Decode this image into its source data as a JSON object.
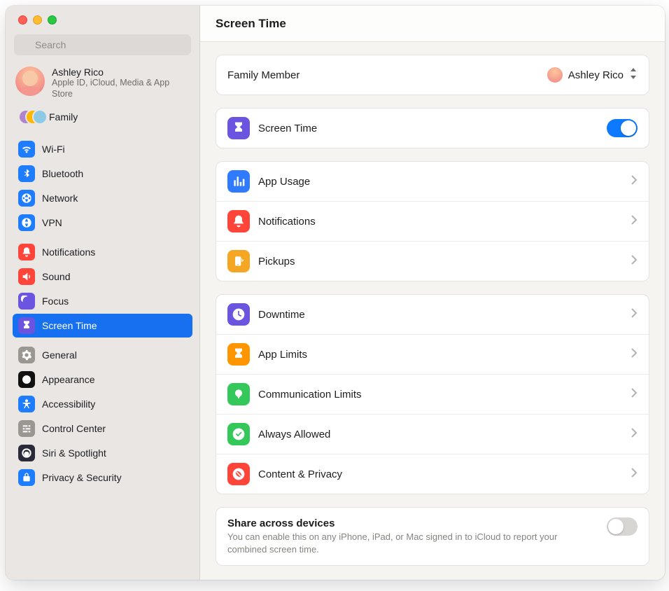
{
  "window": {
    "title": "Screen Time"
  },
  "search": {
    "placeholder": "Search"
  },
  "account": {
    "name": "Ashley Rico",
    "sub": "Apple ID, iCloud, Media & App Store"
  },
  "family": {
    "label": "Family"
  },
  "sidebar": {
    "groups": [
      [
        {
          "id": "wifi",
          "label": "Wi-Fi",
          "color": "#1e7cff"
        },
        {
          "id": "bluetooth",
          "label": "Bluetooth",
          "color": "#1e7cff"
        },
        {
          "id": "network",
          "label": "Network",
          "color": "#1e7cff"
        },
        {
          "id": "vpn",
          "label": "VPN",
          "color": "#1e7cff"
        }
      ],
      [
        {
          "id": "notifications",
          "label": "Notifications",
          "color": "#ff453a"
        },
        {
          "id": "sound",
          "label": "Sound",
          "color": "#ff453a"
        },
        {
          "id": "focus",
          "label": "Focus",
          "color": "#6b55e0"
        },
        {
          "id": "screentime",
          "label": "Screen Time",
          "color": "#6b55e0",
          "selected": true
        }
      ],
      [
        {
          "id": "general",
          "label": "General",
          "color": "#9a9793"
        },
        {
          "id": "appearance",
          "label": "Appearance",
          "color": "#111"
        },
        {
          "id": "accessibility",
          "label": "Accessibility",
          "color": "#1e7cff"
        },
        {
          "id": "controlcenter",
          "label": "Control Center",
          "color": "#9a9793"
        },
        {
          "id": "siri",
          "label": "Siri & Spotlight",
          "color": "#2a2a3a"
        },
        {
          "id": "privacy",
          "label": "Privacy & Security",
          "color": "#1e7cff"
        }
      ]
    ]
  },
  "family_member": {
    "label": "Family Member",
    "selected": "Ashley Rico"
  },
  "screen_time_toggle": {
    "label": "Screen Time",
    "on": true,
    "color": "#6b55e0"
  },
  "sections": [
    [
      {
        "id": "app-usage",
        "label": "App Usage",
        "color": "#2f7bff"
      },
      {
        "id": "notif",
        "label": "Notifications",
        "color": "#ff453a"
      },
      {
        "id": "pickups",
        "label": "Pickups",
        "color": "#f5a623"
      }
    ],
    [
      {
        "id": "downtime",
        "label": "Downtime",
        "color": "#6b55e0"
      },
      {
        "id": "applimits",
        "label": "App Limits",
        "color": "#ff9500"
      },
      {
        "id": "commlimits",
        "label": "Communication Limits",
        "color": "#34c759"
      },
      {
        "id": "always",
        "label": "Always Allowed",
        "color": "#34c759"
      },
      {
        "id": "content",
        "label": "Content & Privacy",
        "color": "#ff453a"
      }
    ]
  ],
  "share": {
    "title": "Share across devices",
    "desc": "You can enable this on any iPhone, iPad, or Mac signed in to iCloud to report your combined screen time.",
    "on": false
  }
}
